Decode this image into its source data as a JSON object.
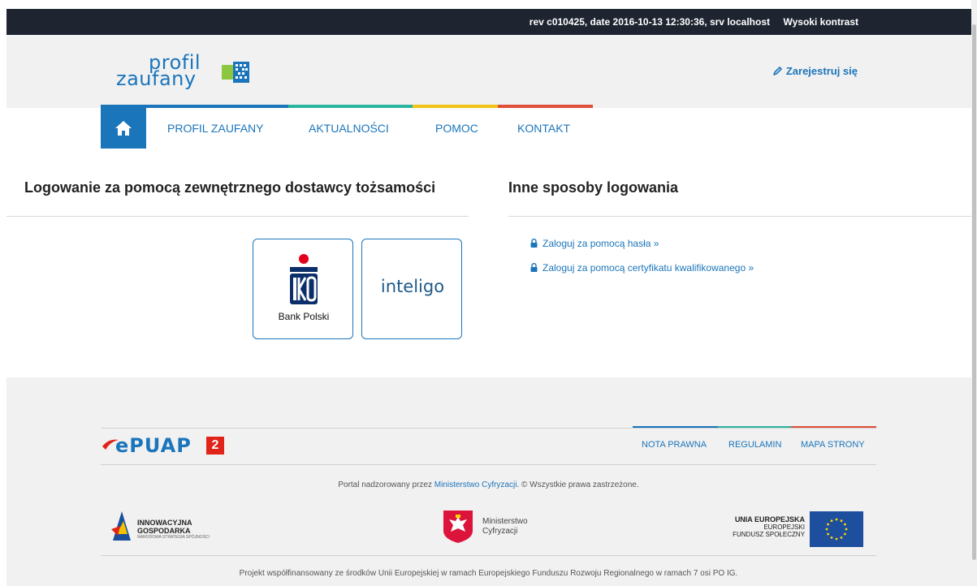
{
  "topbar": {
    "revision_info": "rev c010425, date 2016-10-13 12:30:36, srv localhost",
    "high_contrast": "Wysoki kontrast"
  },
  "header": {
    "logo_line1": "profil",
    "logo_line2": "zaufany",
    "register_label": "Zarejestruj się"
  },
  "nav": {
    "items": [
      "PROFIL ZAUFANY",
      "AKTUALNOŚCI",
      "POMOC",
      "KONTAKT"
    ],
    "colors": [
      "#1b75bb",
      "#2cb5a0",
      "#f0c419",
      "#e0503a"
    ]
  },
  "main": {
    "external_title": "Logowanie za pomocą zewnętrznego dostawcy tożsamości",
    "other_title": "Inne sposoby logowania",
    "providers": {
      "pko_caption": "Bank Polski",
      "inteligo_label": "inteligo"
    },
    "links": [
      "Zaloguj za pomocą hasła »",
      "Zaloguj za pomocą certyfikatu kwalifikowanego »"
    ]
  },
  "footer": {
    "epuap_label": "ePUAP",
    "epuap_badge": "2",
    "links": [
      "NOTA PRAWNA",
      "REGULAMIN",
      "MAPA STRONY"
    ],
    "copyright_prefix": "Portal nadzorowany przez",
    "copyright_ministry": "Ministerstwo Cyfryzacji",
    "copyright_suffix": ". © Wszystkie prawa zastrzeżone.",
    "ig_line1": "INNOWACYJNA",
    "ig_line2": "GOSPODARKA",
    "ig_sub": "NARODOWA STRATEGIA SPÓJNOŚCI",
    "ministry_line1": "Ministerstwo",
    "ministry_line2": "Cyfryzacji",
    "eu_line1": "UNIA EUROPEJSKA",
    "eu_line2": "EUROPEJSKI",
    "eu_line3": "FUNDUSZ SPOŁECZNY",
    "cofinancing": "Projekt współfinansowany ze środków Unii Europejskiej w ramach Europejskiego Funduszu Rozwoju Regionalnego w ramach 7 osi PO IG."
  }
}
